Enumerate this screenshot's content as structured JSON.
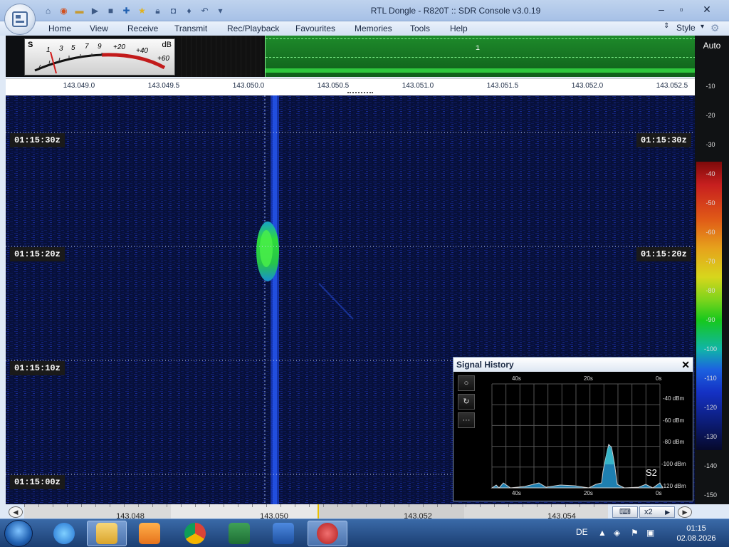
{
  "window": {
    "title": "RTL Dongle - R820T :: SDR Console v3.0.19"
  },
  "menu": {
    "items": [
      "Home",
      "View",
      "Receive",
      "Transmit",
      "Rec/Playback",
      "Favourites",
      "Memories",
      "Tools",
      "Help"
    ],
    "style_label": "Style"
  },
  "smeter": {
    "s_label": "S",
    "db_label": "dB",
    "scale_s": [
      "1",
      "3",
      "5",
      "7",
      "9"
    ],
    "scale_db": [
      "+20",
      "+40",
      "+60"
    ]
  },
  "band": {
    "label": "1",
    "auto_label": "Auto"
  },
  "frequency_scale": {
    "labels": [
      "143.049.0",
      "143.049.5",
      "143.050.0",
      "143.050.5",
      "143.051.0",
      "143.051.5",
      "143.052.0",
      "143.052.5"
    ]
  },
  "waterfall": {
    "time_labels": [
      "01:15:30z",
      "01:15:20z",
      "01:15:10z",
      "01:15:00z"
    ]
  },
  "color_scale": {
    "labels": [
      "-10",
      "-20",
      "-30",
      "-40",
      "-50",
      "-60",
      "-70",
      "-80",
      "-90",
      "-100",
      "-110",
      "-120",
      "-130",
      "-140",
      "-150"
    ]
  },
  "signal_history": {
    "title": "Signal History",
    "time_top": [
      "40s",
      "20s",
      "0s"
    ],
    "time_bottom": [
      "40s",
      "20s",
      "0s"
    ],
    "dbm_labels": [
      "-40 dBm",
      "-60 dBm",
      "-80 dBm",
      "-100 dBm",
      "-120 dBm"
    ],
    "s_reading": "S2",
    "buttons": [
      "○",
      "↻",
      "···"
    ]
  },
  "bottom_scale": {
    "labels": [
      "143.048",
      "143.050",
      "143.052",
      "143.054"
    ],
    "zoom_label": "x2"
  },
  "taskbar": {
    "language": "DE",
    "time": "01:15",
    "date": "02.08.2026"
  },
  "colors": {
    "waterfall_bg": "#06092b",
    "band_green": "#1e8b2b",
    "signal_blob": "#2edc3a"
  }
}
